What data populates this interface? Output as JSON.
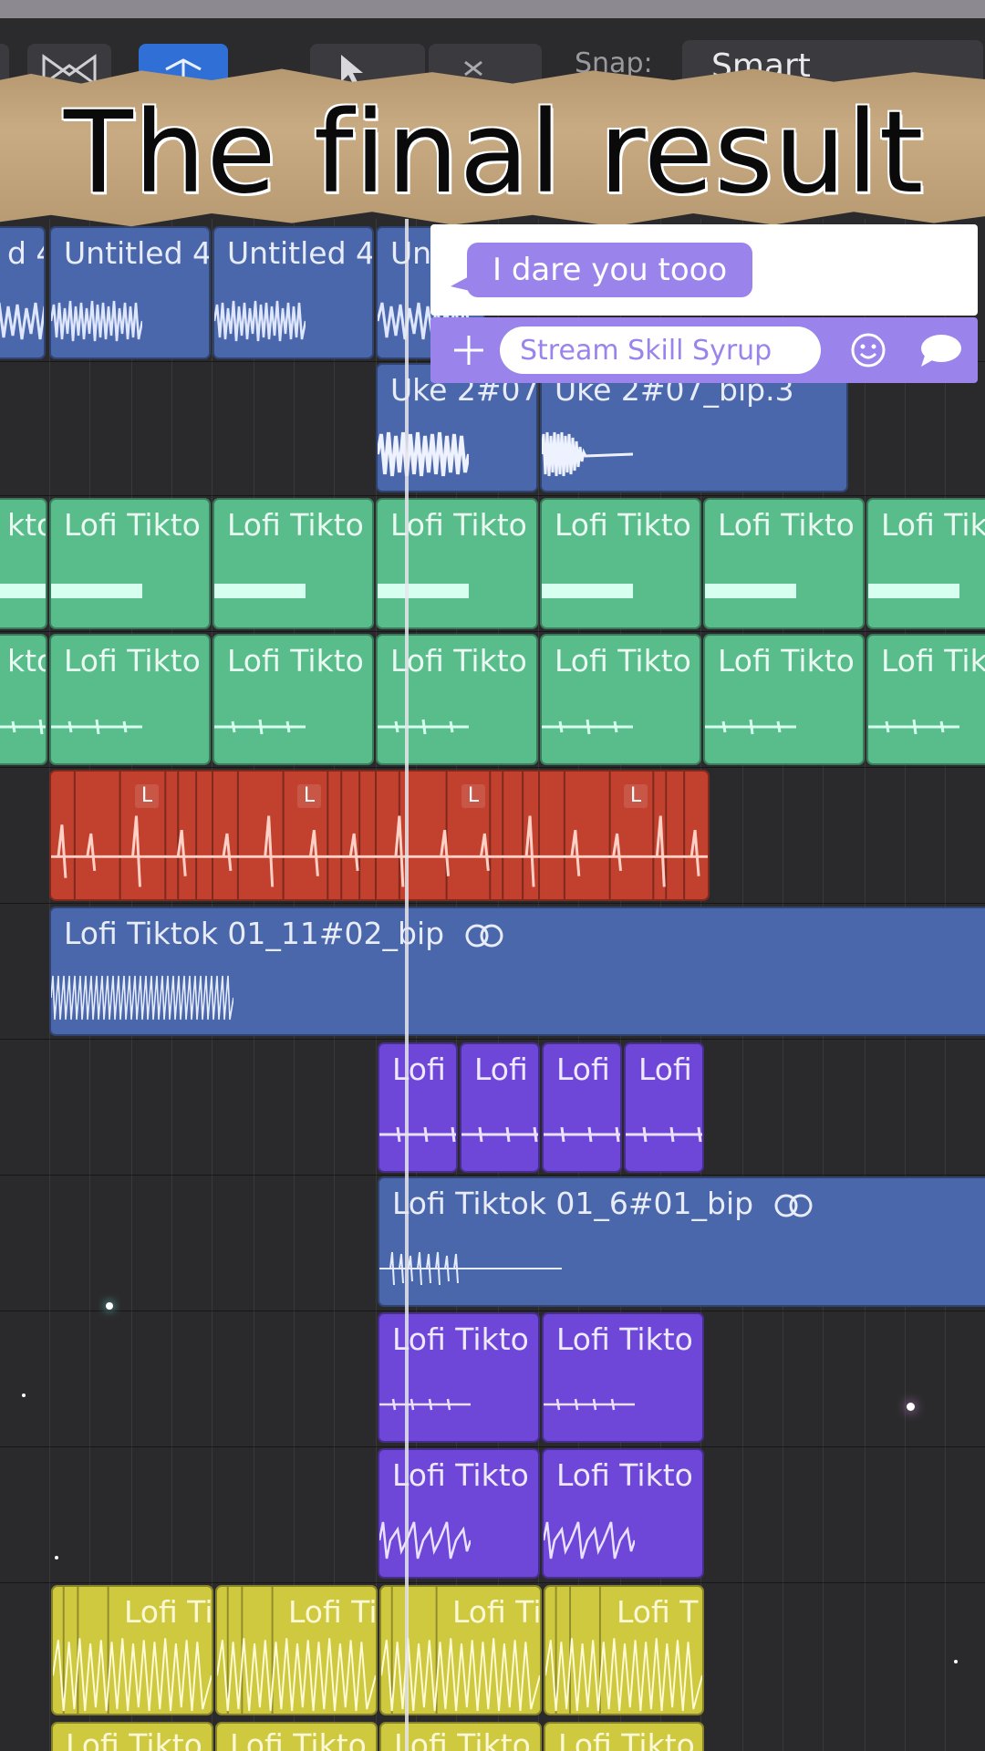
{
  "toolbar": {
    "snap_label": "Snap:",
    "snap_value": "Smart"
  },
  "banner": {
    "title": "The final result"
  },
  "chat": {
    "bubble_text": "I dare you tooo",
    "input_placeholder": "Stream Skill Syrup",
    "accent_color": "#9a84ec"
  },
  "tracks": {
    "row1_labels": [
      "d 4",
      "Untitled 4",
      "Untitled 4",
      "Un"
    ],
    "row2_labels": [
      "Uke 2#07",
      "Uke 2#07_bip.3"
    ],
    "row3_labels": [
      "kto",
      "Lofi Tikto",
      "Lofi Tikto",
      "Lofi Tikto",
      "Lofi Tikto",
      "Lofi Tikto",
      "Lofi Tik"
    ],
    "row4_labels": [
      "kto",
      "Lofi Tikto",
      "Lofi Tikto",
      "Lofi Tikto",
      "Lofi Tikto",
      "Lofi Tikto",
      "Lofi Tik"
    ],
    "row5_marker": "L",
    "row6_label": "Lofi Tiktok 01_11#02_bip",
    "row7_labels": [
      "Lofi",
      "Lofi",
      "Lofi",
      "Lofi"
    ],
    "row8_label": "Lofi Tiktok 01_6#01_bip",
    "row9_labels": [
      "Lofi Tikto",
      "Lofi Tikto"
    ],
    "row10_labels": [
      "Lofi Tikto",
      "Lofi Tikto"
    ],
    "row11_labels": [
      "Lofi Ti",
      "Lofi Ti",
      "Lofi Ti",
      "Lofi T"
    ],
    "row12_labels": [
      "Lofi Tikto",
      "Lofi Tikto",
      "Lofi Tikto",
      "Lofi Tikto"
    ]
  },
  "colors": {
    "blue": "#4a67ab",
    "green": "#58bd8b",
    "red": "#c2402e",
    "violet": "#6e46d8",
    "yellow": "#cfc93f"
  },
  "icons": [
    "cursor-icon",
    "scissors-icon",
    "catch-icon",
    "plus-icon",
    "smiley-icon",
    "speech-bubble-icon",
    "loop-icon"
  ]
}
